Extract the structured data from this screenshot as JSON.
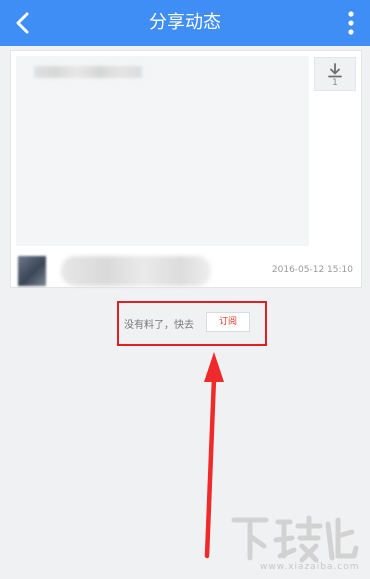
{
  "header": {
    "title": "分享动态"
  },
  "post": {
    "download_count": "1",
    "timestamp": "2016-05-12 15:10"
  },
  "notice": {
    "text": "没有料了，快去",
    "subscribe_label": "订阅"
  },
  "watermark": {
    "site": "www.xiazaiba.com"
  },
  "colors": {
    "header_bg": "#3f8ef5",
    "highlight_box": "#e02020",
    "subscribe_text": "#e03c2a"
  }
}
